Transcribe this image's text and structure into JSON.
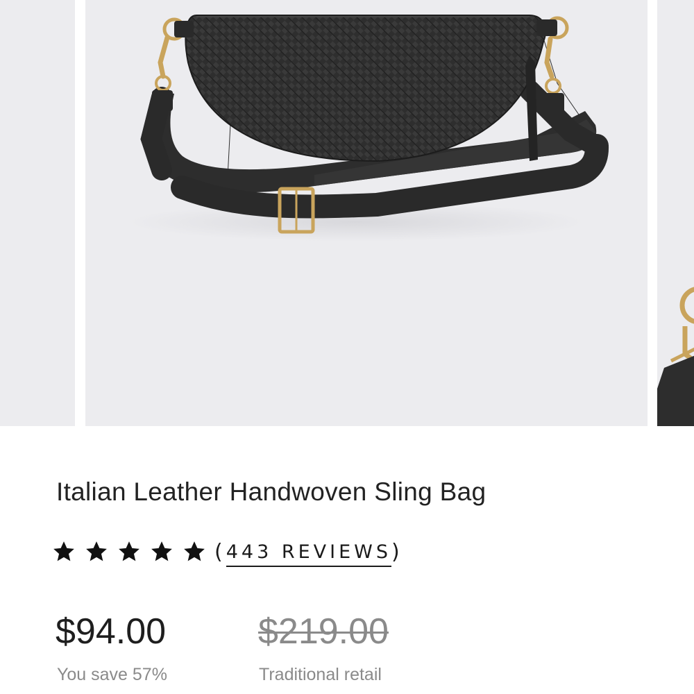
{
  "product": {
    "title": "Italian Leather Handwoven Sling Bag",
    "rating": 5,
    "rating_max": 5,
    "reviews_label": "443 REVIEWS",
    "paren_open": "(",
    "paren_close": ")",
    "price": "$94.00",
    "savings": "You save 57%",
    "original_price": "$219.00",
    "original_price_label": "Traditional retail"
  },
  "colors": {
    "image_background": "#ececef",
    "bag": "#2b2b2b",
    "hardware_gold": "#c9a45c",
    "muted_text": "#8a8a8a"
  },
  "icons": {
    "rating_star": "star-icon"
  }
}
